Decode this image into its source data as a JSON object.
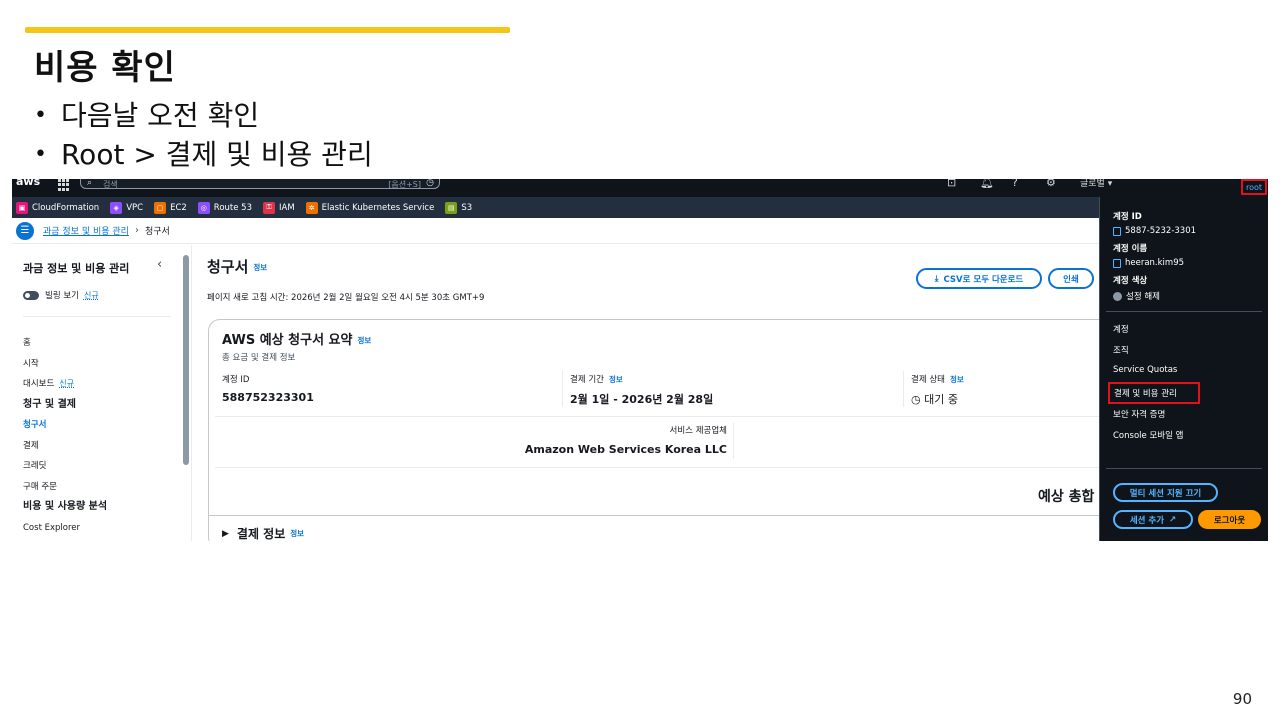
{
  "slide": {
    "title": "비용 확인",
    "bullets": [
      "다음날 오전 확인",
      "Root > 결제 및 비용 관리"
    ],
    "page_number": "90"
  },
  "colors": {
    "accent_bar": "#f5c518",
    "highlight_box": "#e3111b",
    "link_blue": "#0972d3",
    "nav_dark": "#0f141a",
    "logout_orange": "#ff9900"
  },
  "topnav": {
    "search_placeholder": "검색",
    "search_shortcut": "[옵션+S]",
    "region": "글로벌 ▾",
    "account_button": "root"
  },
  "favorites": [
    {
      "label": "CloudFormation",
      "icon": "cloudformation-icon",
      "color": "#e7157b"
    },
    {
      "label": "VPC",
      "icon": "vpc-icon",
      "color": "#8c4fff"
    },
    {
      "label": "EC2",
      "icon": "ec2-icon",
      "color": "#ed7100"
    },
    {
      "label": "Route 53",
      "icon": "route53-icon",
      "color": "#8c4fff"
    },
    {
      "label": "IAM",
      "icon": "iam-icon",
      "color": "#dd344c"
    },
    {
      "label": "Elastic Kubernetes Service",
      "icon": "eks-icon",
      "color": "#ed7100"
    },
    {
      "label": "S3",
      "icon": "s3-icon",
      "color": "#7aa116"
    }
  ],
  "breadcrumb": {
    "link": "과금 정보 및 비용 관리",
    "current": "청구서"
  },
  "sidebar": {
    "title": "과금 정보 및 비용 관리",
    "toggle_label": "빌링 보기",
    "new_badge": "신규",
    "items": [
      {
        "label": "홈",
        "type": "item"
      },
      {
        "label": "시작",
        "type": "item"
      },
      {
        "label": "대시보드",
        "type": "item",
        "badge": "신규"
      },
      {
        "label": "청구 및 결제",
        "type": "head"
      },
      {
        "label": "청구서",
        "type": "active"
      },
      {
        "label": "결제",
        "type": "item"
      },
      {
        "label": "크레딧",
        "type": "item"
      },
      {
        "label": "구매 주문",
        "type": "item"
      },
      {
        "label": "비용 및 사용량 분석",
        "type": "head"
      },
      {
        "label": "Cost Explorer",
        "type": "item"
      }
    ]
  },
  "main": {
    "title": "청구서",
    "info": "정보",
    "refresh_text": "페이지 새로 고침 시간: 2026년 2월 2일 월요일 오전 4시 5분 30초 GMT+9",
    "csv_button": "CSV로 모두 다운로드",
    "print_button": "인쇄",
    "summary": {
      "title": "AWS 예상 청구서 요약",
      "subtitle": "총 요금 및 결제 정보",
      "account_id_label": "계정 ID",
      "account_id_value": "588752323301",
      "period_label": "결제 기간",
      "period_value": "2월 1일 - 2026년 2월 28일",
      "status_label": "결제 상태",
      "status_value": "대기 중",
      "provider_label": "서비스 제공업체",
      "provider_value": "Amazon Web Services Korea LLC",
      "total_label": "예상 총합"
    },
    "payment_section": "결제 정보"
  },
  "account_menu": {
    "account_id_label": "계정 ID",
    "account_id_value": "5887-5232-3301",
    "account_name_label": "계정 이름",
    "account_name_value": "heeran.kim95",
    "account_color_label": "계정 색상",
    "account_color_value": "설정 해제",
    "links": [
      "계정",
      "조직",
      "Service Quotas",
      "결제 및 비용 관리",
      "보안 자격 증명",
      "Console 모바일 앱"
    ],
    "multi_session_button": "멀티 세션 지원 끄기",
    "add_session_button": "세션 추가",
    "logout_button": "로그아웃"
  }
}
